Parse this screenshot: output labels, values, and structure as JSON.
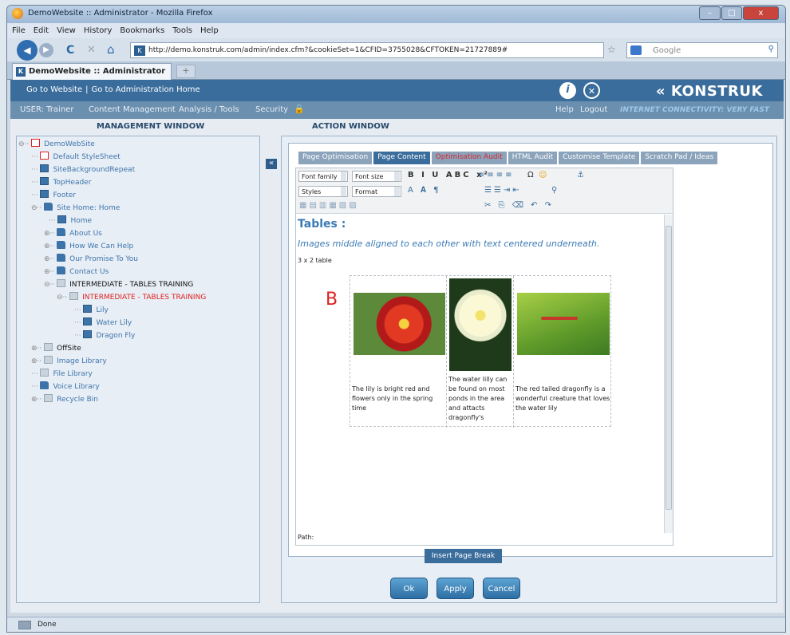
{
  "window": {
    "title": "DemoWebsite :: Administrator - Mozilla Firefox",
    "min": "–",
    "max": "□",
    "close": "x"
  },
  "menu": [
    "File",
    "Edit",
    "View",
    "History",
    "Bookmarks",
    "Tools",
    "Help"
  ],
  "nav": {
    "url": "http://demo.konstruk.com/admin/index.cfm?&cookieSet=1&CFID=3755028&CFTOKEN=21727889#",
    "search_placeholder": "Google",
    "back": "◀",
    "reload": "C",
    "stop": "✕",
    "home": "⌂",
    "star": "☆"
  },
  "tab": {
    "label": "DemoWebsite :: Administrator",
    "new_tab": "+"
  },
  "header": {
    "link_website": "Go to Website",
    "sep": "|",
    "link_admin": "Go to Administration Home",
    "info": "i",
    "close": "✕",
    "logo": "KONSTRUK",
    "logo_mark": "«"
  },
  "subheader": {
    "user": "USER: Trainer",
    "content": "Content Management",
    "analysis": "Analysis / Tools",
    "security": "Security",
    "help": "Help",
    "logout": "Logout",
    "speed": "INTERNET CONNECTIVITY: VERY FAST"
  },
  "panels": {
    "management": "MANAGEMENT WINDOW",
    "action": "ACTION WINDOW",
    "collapse": "«"
  },
  "tree": [
    {
      "label": "DemoWebSite"
    },
    {
      "label": "Default StyleSheet"
    },
    {
      "label": "SiteBackgroundRepeat"
    },
    {
      "label": "TopHeader"
    },
    {
      "label": "Footer"
    },
    {
      "label": "Site Home: Home"
    },
    {
      "label": "Home"
    },
    {
      "label": "About Us"
    },
    {
      "label": "How We Can Help"
    },
    {
      "label": "Our Promise To You"
    },
    {
      "label": "Contact Us"
    },
    {
      "label": "INTERMEDIATE - TABLES TRAINING"
    },
    {
      "label": "INTERMEDIATE - TABLES TRAINING"
    },
    {
      "label": "Lily"
    },
    {
      "label": "Water Lily"
    },
    {
      "label": "Dragon Fly"
    },
    {
      "label": "OffSite"
    },
    {
      "label": "Image Library"
    },
    {
      "label": "File Library"
    },
    {
      "label": "Voice Library"
    },
    {
      "label": "Recycle Bin"
    }
  ],
  "action_tabs": [
    "Page Optimisation",
    "Page Content",
    "Optimisation Audit",
    "HTML Audit",
    "Customise Template",
    "Scratch Pad / Ideas"
  ],
  "toolbar": {
    "font_family": "Font family",
    "font_size": "Font size",
    "styles": "Styles",
    "format": "Format",
    "row1": "B I U ABC x²",
    "row1b": "Ω",
    "row2": "A 𝐀 ¶",
    "row3": "✂ ⎘ ⌫ ↶ ↷"
  },
  "doc": {
    "heading": "Tables :",
    "subheading": "Images middle aligned to each other with text centered underneath.",
    "note": "3 x 2 table",
    "marker": "B",
    "captions": [
      "The lily is bright red and flowers only in the spring time",
      "The water lilly can be found on most ponds in the area and attacts dragonfly's",
      "The red tailed dragonfly is a wonderful creature that loves the water lily"
    ],
    "path": "Path:"
  },
  "buttons": {
    "page_break": "Insert Page Break",
    "ok": "Ok",
    "apply": "Apply",
    "cancel": "Cancel"
  },
  "status": "Done"
}
